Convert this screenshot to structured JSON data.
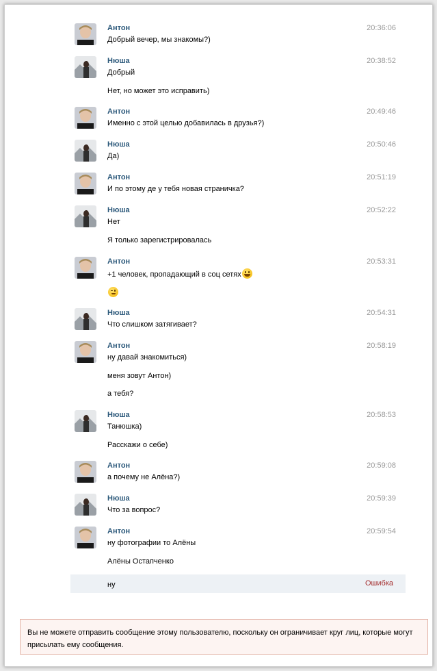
{
  "messages": [
    {
      "author": "Антон",
      "time": "20:36:06",
      "lines": [
        "Добрый вечер, мы знакомы?)"
      ]
    },
    {
      "author": "Нюша",
      "time": "20:38:52",
      "lines": [
        "Добрый",
        "Нет, но может это исправить)"
      ]
    },
    {
      "author": "Антон",
      "time": "20:49:46",
      "lines": [
        "Именно с этой целью добавилась в друзья?)"
      ]
    },
    {
      "author": "Нюша",
      "time": "20:50:46",
      "lines": [
        "Да)"
      ]
    },
    {
      "author": "Антон",
      "time": "20:51:19",
      "lines": [
        "И по этому де у тебя новая страничка?"
      ]
    },
    {
      "author": "Нюша",
      "time": "20:52:22",
      "lines": [
        "Нет",
        "Я только зарегистрировалась"
      ]
    },
    {
      "author": "Антон",
      "time": "20:53:31",
      "lines": [
        "+1 человек, пропадающий в соц сетях"
      ]
    },
    {
      "author": "Нюша",
      "time": "20:54:31",
      "lines": [
        "Что слишком затягивает?"
      ]
    },
    {
      "author": "Антон",
      "time": "20:58:19",
      "lines": [
        "ну давай знакомиться)",
        "меня зовут Антон)",
        "а тебя?"
      ]
    },
    {
      "author": "Нюша",
      "time": "20:58:53",
      "lines": [
        "Танюшка)",
        "Расскажи о себе)"
      ]
    },
    {
      "author": "Антон",
      "time": "20:59:08",
      "lines": [
        "а почему не Алёна?)"
      ]
    },
    {
      "author": "Нюша",
      "time": "20:59:39",
      "lines": [
        "Что за вопрос?"
      ]
    },
    {
      "author": "Антон",
      "time": "20:59:54",
      "lines": [
        "ну фотографии то Алёны",
        "Алёны Остапченко"
      ]
    }
  ],
  "failed_message": {
    "text": "ну",
    "status": "Ошибка"
  },
  "notice": "Вы не можете отправить сообщение этому пользователю, поскольку он ограничивает круг лиц, которые могут присылать ему сообщения.",
  "icons": {
    "smile": "grinning-emoji",
    "wink": "wink-emoji"
  },
  "colors": {
    "author": "#2b587a",
    "time": "#999999",
    "error": "#a32b2b",
    "notice_bg": "#fdf4f2",
    "notice_border": "#e3b3a6",
    "failed_bg": "#edf1f5"
  }
}
